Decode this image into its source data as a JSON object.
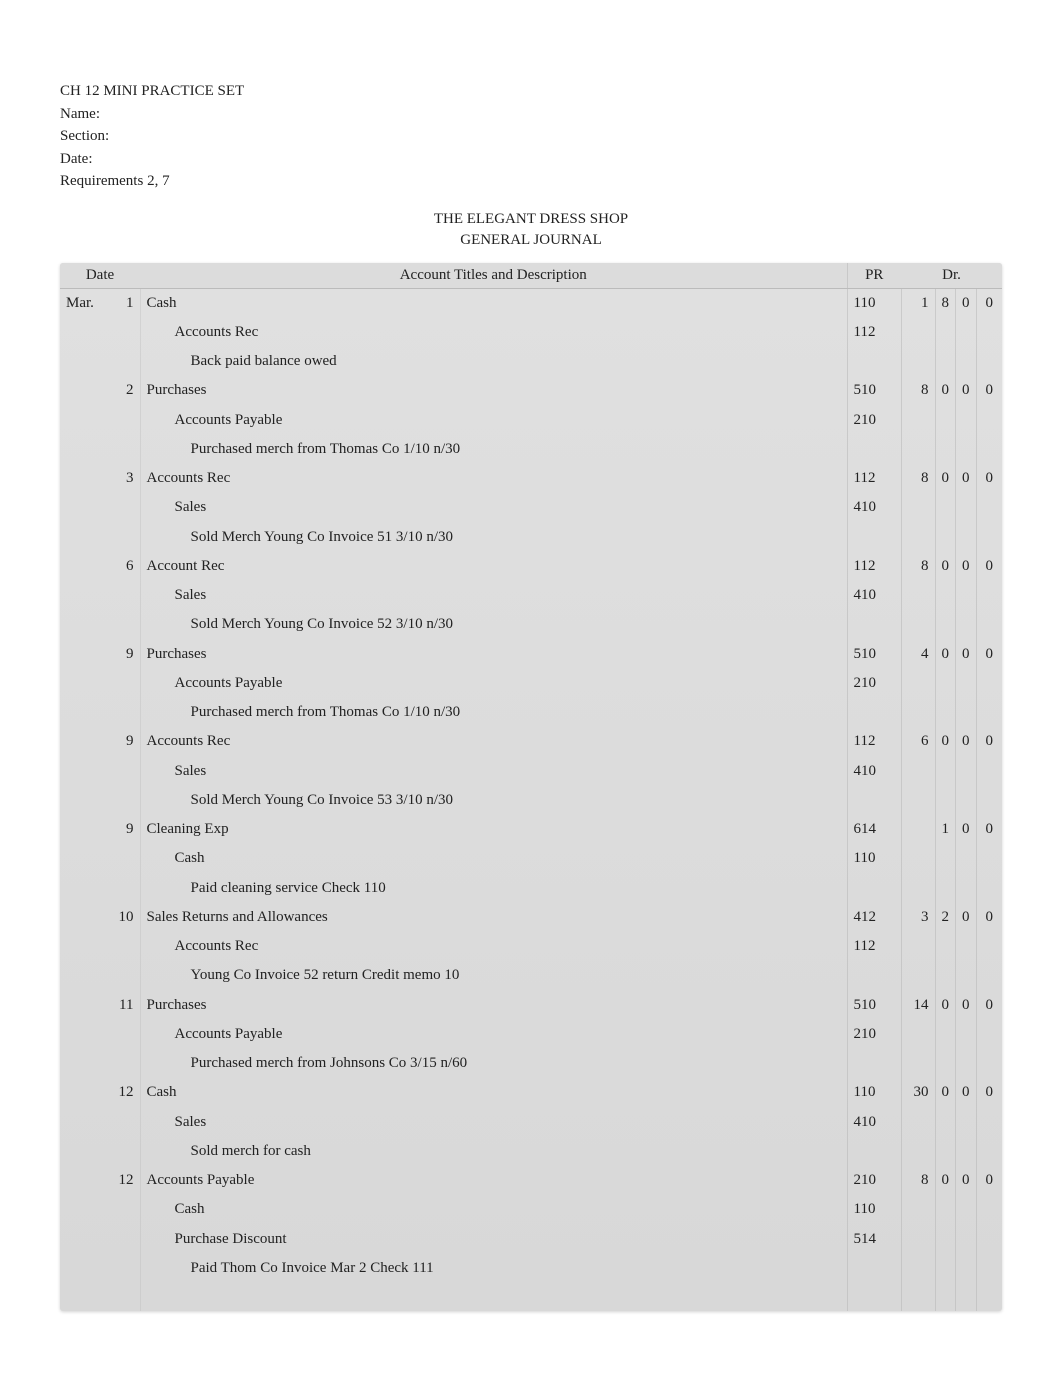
{
  "header": {
    "title": "CH 12 MINI PRACTICE SET",
    "name_label": "Name:",
    "section_label": "Section:",
    "date_label": "Date:",
    "requirements": "Requirements 2, 7"
  },
  "report": {
    "company": "THE ELEGANT DRESS SHOP",
    "document": "GENERAL JOURNAL"
  },
  "columns": {
    "date": "Date",
    "acct": "Account Titles and Description",
    "pr": "PR",
    "dr": "Dr."
  },
  "month": "Mar.",
  "entries": [
    {
      "day": "1",
      "lines": [
        {
          "text": "Cash",
          "indent": 0,
          "pr": "110",
          "dr": [
            "1",
            "8",
            "0",
            "0"
          ]
        },
        {
          "text": "Accounts Rec",
          "indent": 1,
          "pr": "112",
          "dr": [
            "",
            "",
            "",
            ""
          ]
        },
        {
          "text": "Back paid balance owed",
          "indent": 2,
          "pr": "",
          "dr": [
            "",
            "",
            "",
            ""
          ]
        }
      ]
    },
    {
      "day": "2",
      "lines": [
        {
          "text": "Purchases",
          "indent": 0,
          "pr": "510",
          "dr": [
            "8",
            "0",
            "0",
            "0"
          ]
        },
        {
          "text": "Accounts Payable",
          "indent": 1,
          "pr": "210",
          "dr": [
            "",
            "",
            "",
            ""
          ]
        },
        {
          "text": "Purchased merch from Thomas Co 1/10 n/30",
          "indent": 2,
          "pr": "",
          "dr": [
            "",
            "",
            "",
            ""
          ]
        }
      ]
    },
    {
      "day": "3",
      "lines": [
        {
          "text": "Accounts Rec",
          "indent": 0,
          "pr": "112",
          "dr": [
            "8",
            "0",
            "0",
            "0"
          ]
        },
        {
          "text": "Sales",
          "indent": 1,
          "pr": "410",
          "dr": [
            "",
            "",
            "",
            ""
          ]
        },
        {
          "text": "Sold Merch Young Co Invoice 51 3/10 n/30",
          "indent": 2,
          "pr": "",
          "dr": [
            "",
            "",
            "",
            ""
          ]
        }
      ]
    },
    {
      "day": "6",
      "lines": [
        {
          "text": "Account Rec",
          "indent": 0,
          "pr": "112",
          "dr": [
            "8",
            "0",
            "0",
            "0"
          ]
        },
        {
          "text": "Sales",
          "indent": 1,
          "pr": "410",
          "dr": [
            "",
            "",
            "",
            ""
          ]
        },
        {
          "text": "Sold Merch Young Co Invoice 52 3/10 n/30",
          "indent": 2,
          "pr": "",
          "dr": [
            "",
            "",
            "",
            ""
          ]
        }
      ]
    },
    {
      "day": "9",
      "lines": [
        {
          "text": "Purchases",
          "indent": 0,
          "pr": "510",
          "dr": [
            "4",
            "0",
            "0",
            "0"
          ]
        },
        {
          "text": "Accounts Payable",
          "indent": 1,
          "pr": "210",
          "dr": [
            "",
            "",
            "",
            ""
          ]
        },
        {
          "text": "Purchased merch from Thomas Co 1/10 n/30",
          "indent": 2,
          "pr": "",
          "dr": [
            "",
            "",
            "",
            ""
          ]
        }
      ]
    },
    {
      "day": "9",
      "lines": [
        {
          "text": "Accounts Rec",
          "indent": 0,
          "pr": "112",
          "dr": [
            "6",
            "0",
            "0",
            "0"
          ]
        },
        {
          "text": "Sales",
          "indent": 1,
          "pr": "410",
          "dr": [
            "",
            "",
            "",
            ""
          ]
        },
        {
          "text": "Sold Merch Young Co Invoice 53 3/10 n/30",
          "indent": 2,
          "pr": "",
          "dr": [
            "",
            "",
            "",
            ""
          ]
        }
      ]
    },
    {
      "day": "9",
      "lines": [
        {
          "text": "Cleaning Exp",
          "indent": 0,
          "pr": "614",
          "dr": [
            "",
            "1",
            "0",
            "0"
          ]
        },
        {
          "text": "Cash",
          "indent": 1,
          "pr": "110",
          "dr": [
            "",
            "",
            "",
            ""
          ]
        },
        {
          "text": "Paid cleaning service Check 110",
          "indent": 2,
          "pr": "",
          "dr": [
            "",
            "",
            "",
            ""
          ]
        }
      ]
    },
    {
      "day": "10",
      "lines": [
        {
          "text": "Sales Returns and Allowances",
          "indent": 0,
          "pr": "412",
          "dr": [
            "3",
            "2",
            "0",
            "0"
          ]
        },
        {
          "text": "Accounts Rec",
          "indent": 1,
          "pr": "112",
          "dr": [
            "",
            "",
            "",
            ""
          ]
        },
        {
          "text": "Young Co Invoice 52 return Credit memo 10",
          "indent": 2,
          "pr": "",
          "dr": [
            "",
            "",
            "",
            ""
          ]
        }
      ]
    },
    {
      "day": "11",
      "lines": [
        {
          "text": "Purchases",
          "indent": 0,
          "pr": "510",
          "dr": [
            "14",
            "0",
            "0",
            "0"
          ]
        },
        {
          "text": "Accounts Payable",
          "indent": 1,
          "pr": "210",
          "dr": [
            "",
            "",
            "",
            ""
          ]
        },
        {
          "text": "Purchased merch from Johnsons Co 3/15 n/60",
          "indent": 2,
          "pr": "",
          "dr": [
            "",
            "",
            "",
            ""
          ]
        }
      ]
    },
    {
      "day": "12",
      "lines": [
        {
          "text": "Cash",
          "indent": 0,
          "pr": "110",
          "dr": [
            "30",
            "0",
            "0",
            "0"
          ]
        },
        {
          "text": "Sales",
          "indent": 1,
          "pr": "410",
          "dr": [
            "",
            "",
            "",
            ""
          ]
        },
        {
          "text": "Sold merch for cash",
          "indent": 2,
          "pr": "",
          "dr": [
            "",
            "",
            "",
            ""
          ]
        }
      ]
    },
    {
      "day": "12",
      "lines": [
        {
          "text": "Accounts Payable",
          "indent": 0,
          "pr": "210",
          "dr": [
            "8",
            "0",
            "0",
            "0"
          ]
        },
        {
          "text": "Cash",
          "indent": 1,
          "pr": "110",
          "dr": [
            "",
            "",
            "",
            ""
          ]
        },
        {
          "text": "Purchase Discount",
          "indent": 1,
          "pr": "514",
          "dr": [
            "",
            "",
            "",
            ""
          ]
        },
        {
          "text": "Paid Thom Co Invoice Mar 2 Check 111",
          "indent": 2,
          "pr": "",
          "dr": [
            "",
            "",
            "",
            ""
          ]
        }
      ]
    }
  ]
}
